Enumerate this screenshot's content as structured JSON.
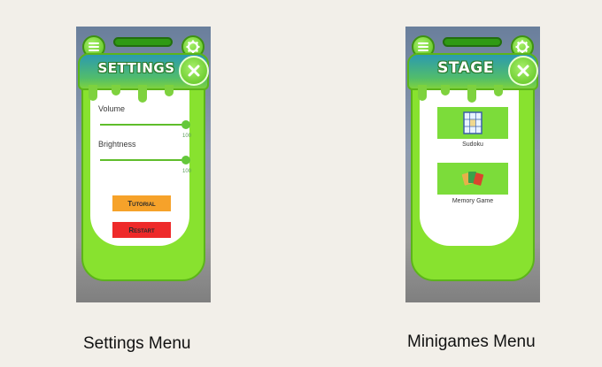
{
  "settings_screen": {
    "title": "SETTINGS",
    "sliders": [
      {
        "label": "Volume",
        "value": "100",
        "level": 1.0
      },
      {
        "label": "Brightness",
        "value": "100",
        "level": 1.0
      }
    ],
    "buttons": [
      {
        "label": "Tutorial",
        "color": "#f6a22a"
      },
      {
        "label": "Restart",
        "color": "#ee2a2a"
      }
    ],
    "caption": "Settings Menu"
  },
  "minigames_screen": {
    "title": "STAGE",
    "games": [
      {
        "label": "Sudoku",
        "icon": "sudoku-grid-icon"
      },
      {
        "label": "Memory Game",
        "icon": "playing-cards-icon"
      }
    ],
    "caption": "Minigames Menu"
  },
  "colors": {
    "accent_green": "#88e22f",
    "banner_teal": "#2b9ab0",
    "page_bg": "#f2efe9"
  }
}
